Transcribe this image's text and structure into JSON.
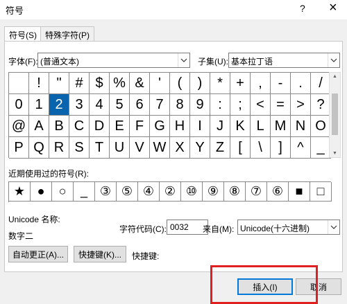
{
  "window": {
    "title": "符号",
    "help": "?",
    "close": "×"
  },
  "tabs": [
    "符号(S)",
    "特殊字符(P)"
  ],
  "font": {
    "label": "字体(F):",
    "value": "(普通文本)"
  },
  "subset": {
    "label": "子集(U):",
    "value": "基本拉丁语"
  },
  "symbols": [
    [
      "",
      "!",
      "\"",
      "#",
      "$",
      "%",
      "&",
      "'",
      "(",
      ")",
      "*",
      "+",
      ",",
      "-",
      ".",
      "/"
    ],
    [
      "0",
      "1",
      "2",
      "3",
      "4",
      "5",
      "6",
      "7",
      "8",
      "9",
      ":",
      ";",
      "<",
      "=",
      ">",
      "?"
    ],
    [
      "@",
      "A",
      "B",
      "C",
      "D",
      "E",
      "F",
      "G",
      "H",
      "I",
      "J",
      "K",
      "L",
      "M",
      "N",
      "O"
    ],
    [
      "P",
      "Q",
      "R",
      "S",
      "T",
      "U",
      "V",
      "W",
      "X",
      "Y",
      "Z",
      "[",
      "\\",
      "]",
      "^",
      "_"
    ]
  ],
  "selected_symbol": "2",
  "recent": {
    "label": "近期使用过的符号(R):",
    "items": [
      "★",
      "●",
      "○",
      "_",
      "③",
      "⑤",
      "④",
      "②",
      "⑩",
      "⑨",
      "⑧",
      "⑦",
      "⑥",
      "■",
      "□"
    ]
  },
  "unicode_name": {
    "label": "Unicode 名称:",
    "value": "数字二"
  },
  "char_code": {
    "label": "字符代码(C):",
    "value": "0032"
  },
  "from": {
    "label": "来自(M):",
    "value": "Unicode(十六进制)"
  },
  "buttons": {
    "autocorrect": "自动更正(A)...",
    "shortcut_key": "快捷键(K)...",
    "shortcut_label": "快捷键:",
    "insert": "插入(I)",
    "cancel": "取消"
  }
}
